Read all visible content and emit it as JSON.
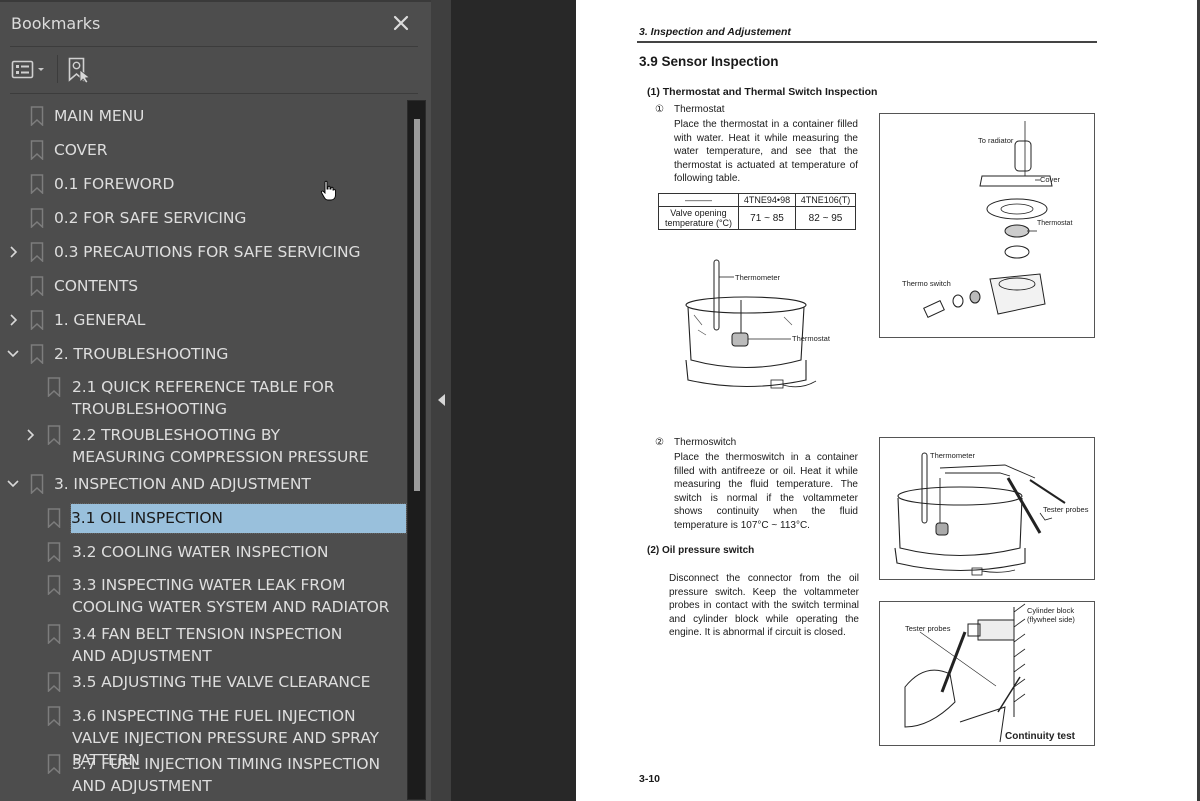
{
  "panel": {
    "title": "Bookmarks",
    "close_icon": "close-icon",
    "toolbar": {
      "options_icon": "list-options-icon",
      "find_bookmark_icon": "find-current-bookmark-icon"
    }
  },
  "bookmarks": [
    {
      "label": "MAIN MENU",
      "level": 0,
      "expander": "none"
    },
    {
      "label": "COVER",
      "level": 0,
      "expander": "none"
    },
    {
      "label": "0.1 FOREWORD",
      "level": 0,
      "expander": "none"
    },
    {
      "label": "0.2 FOR SAFE SERVICING",
      "level": 0,
      "expander": "none"
    },
    {
      "label": "0.3 PRECAUTIONS FOR SAFE SERVICING",
      "level": 0,
      "expander": "collapsed"
    },
    {
      "label": "CONTENTS",
      "level": 0,
      "expander": "none"
    },
    {
      "label": "1. GENERAL",
      "level": 0,
      "expander": "collapsed"
    },
    {
      "label": "2. TROUBLESHOOTING",
      "level": 0,
      "expander": "expanded"
    },
    {
      "label": "2.1 QUICK REFERENCE TABLE FOR TROUBLESHOOTING",
      "level": 1,
      "expander": "none"
    },
    {
      "label": "2.2 TROUBLESHOOTING BY MEASURING COMPRESSION PRESSURE",
      "level": 1,
      "expander": "collapsed"
    },
    {
      "label": "3. INSPECTION AND ADJUSTMENT",
      "level": 0,
      "expander": "expanded"
    },
    {
      "label": "3.1 OIL INSPECTION",
      "level": 1,
      "expander": "none",
      "selected": true
    },
    {
      "label": "3.2 COOLING WATER INSPECTION",
      "level": 1,
      "expander": "none"
    },
    {
      "label": "3.3 INSPECTING WATER LEAK FROM COOLING WATER SYSTEM AND RADIATOR",
      "level": 1,
      "expander": "none"
    },
    {
      "label": "3.4 FAN BELT TENSION INSPECTION AND ADJUSTMENT",
      "level": 1,
      "expander": "none"
    },
    {
      "label": "3.5 ADJUSTING THE VALVE CLEARANCE",
      "level": 1,
      "expander": "none"
    },
    {
      "label": "3.6 INSPECTING THE FUEL INJECTION VALVE INJECTION PRESSURE AND SPRAY PATTERN",
      "level": 1,
      "expander": "none"
    },
    {
      "label": "3.7 FUEL INJECTION TIMING INSPECTION AND ADJUSTMENT",
      "level": 1,
      "expander": "none"
    }
  ],
  "colors": {
    "panel_bg": "#4d4d4d",
    "selection_bg": "#99c0dc",
    "viewer_bg": "#282828",
    "text": "#dedede"
  },
  "document": {
    "running_head": "3.  Inspection and Adjustement",
    "section_title": "3.9  Sensor Inspection",
    "subsection_1": "(1) Thermostat and Thermal Switch Inspection",
    "step1_num": "①",
    "step1_title": "Thermostat",
    "step1_text": "Place the thermostat in a container filled with water. Heat it while measuring the water temperature, and see that the thermostat is actuated at temperature of following table.",
    "table": {
      "header": [
        "———",
        "4TNE94•98",
        "4TNE106(T)"
      ],
      "rows": [
        {
          "label": "Valve opening temperature (°C)",
          "values": [
            "71 ~ 85",
            "82 ~ 95"
          ]
        }
      ]
    },
    "fig1_labels": {
      "thermometer": "Thermometer",
      "thermostat": "Thermostat"
    },
    "fig2_labels": {
      "to_radiator": "To radiator",
      "cover": "Cover",
      "thermostat": "Thermostat",
      "thermo_switch": "Thermo switch"
    },
    "step2_num": "②",
    "step2_title": "Thermoswitch",
    "step2_text": "Place the thermoswitch in a container filled with antifreeze or oil. Heat it while measuring the fluid temperature. The switch is normal if the voltammeter shows continuity when the fluid temperature is 107°C ~ 113°C.",
    "fig3_labels": {
      "thermometer": "Thermometer",
      "tester_probes": "Tester probes"
    },
    "subsection_2": "(2)  Oil pressure switch",
    "sub2_text": "Disconnect the connector from the oil pressure switch. Keep the voltammeter probes in contact with the switch terminal and cylinder block while operating the engine. It is abnormal if circuit is closed.",
    "fig4_labels": {
      "cylinder_block": "Cylinder block",
      "flywheel_side": "(flywheel side)",
      "tester_probes": "Tester probes",
      "caption": "Continuity test"
    },
    "page_number": "3-10"
  }
}
